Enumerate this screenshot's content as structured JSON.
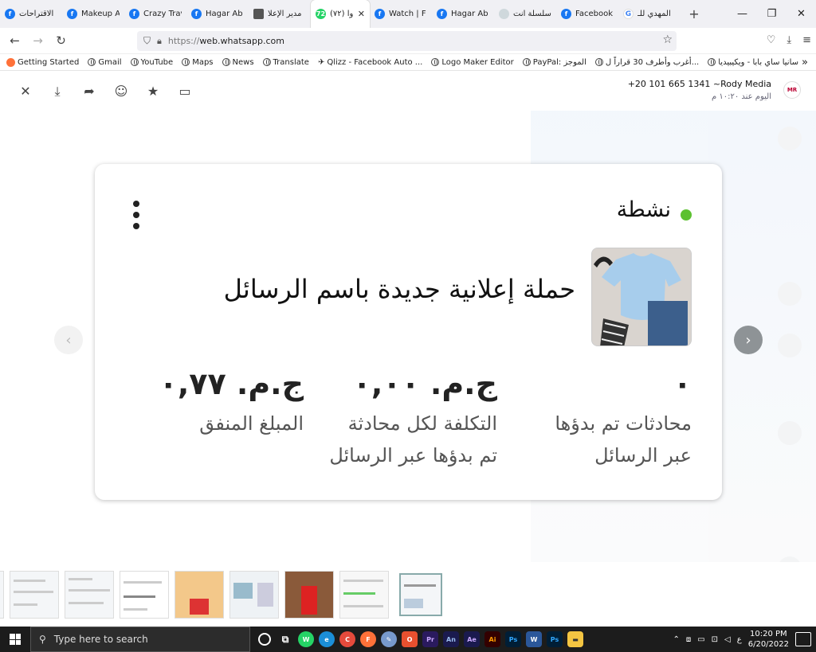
{
  "browser": {
    "tabs": [
      {
        "label": "الاقتراحات",
        "icon": "facebook-icon"
      },
      {
        "label": "Makeup A",
        "icon": "facebook-icon"
      },
      {
        "label": "Crazy Trav",
        "icon": "facebook-icon"
      },
      {
        "label": "Hagar Ab",
        "icon": "facebook-icon"
      },
      {
        "label": "مدير الإعلا",
        "icon": "document-icon"
      },
      {
        "label": "(٧٢) وا",
        "icon": "whatsapp-icon",
        "badge": "72",
        "active": true
      },
      {
        "label": "Watch | F",
        "icon": "facebook-icon"
      },
      {
        "label": "Hagar Ab",
        "icon": "facebook-icon"
      },
      {
        "label": "سلسلة انت",
        "icon": "cloud-icon"
      },
      {
        "label": "Facebook",
        "icon": "facebook-icon"
      },
      {
        "label": "المهدي للـ",
        "icon": "google-icon"
      }
    ],
    "url_prefix": "https://",
    "url_host": "web.whatsapp.com",
    "bookmarks": [
      "Getting Started",
      "Gmail",
      "YouTube",
      "Maps",
      "News",
      "Translate",
      "Qlizz - Facebook Auto ...",
      "Logo Maker Editor",
      "PayPal: الموجز",
      "أغرب وأطرف 30 قراراً ل...",
      "سانيا ساي بابا - ويكيبيديا"
    ]
  },
  "viewer": {
    "sender_name": "+20 101 665 1341 ~Rody Media",
    "timestamp": "اليوم عند ١٠:٢٠ م",
    "logo_text": "MR"
  },
  "card": {
    "status": "نشطة",
    "title": "حملة إعلانية جديدة باسم الرسائل",
    "metrics": [
      {
        "value": "٠",
        "label_line1": "محادثات تم بدؤها",
        "label_line2": "عبر الرسائل"
      },
      {
        "value": "ج.م. ٠,٠٠",
        "label_line1": "التكلفة لكل محادثة",
        "label_line2": "تم بدؤها عبر الرسائل"
      },
      {
        "value": "ج.م. ٠,٧٧",
        "label_line1": "المبلغ المنفق",
        "label_line2": ""
      }
    ],
    "status_color": "#5cc130"
  },
  "taskbar": {
    "search_placeholder": "Type here to search",
    "time": "10:20 PM",
    "date": "6/20/2022",
    "lang": "ع"
  }
}
